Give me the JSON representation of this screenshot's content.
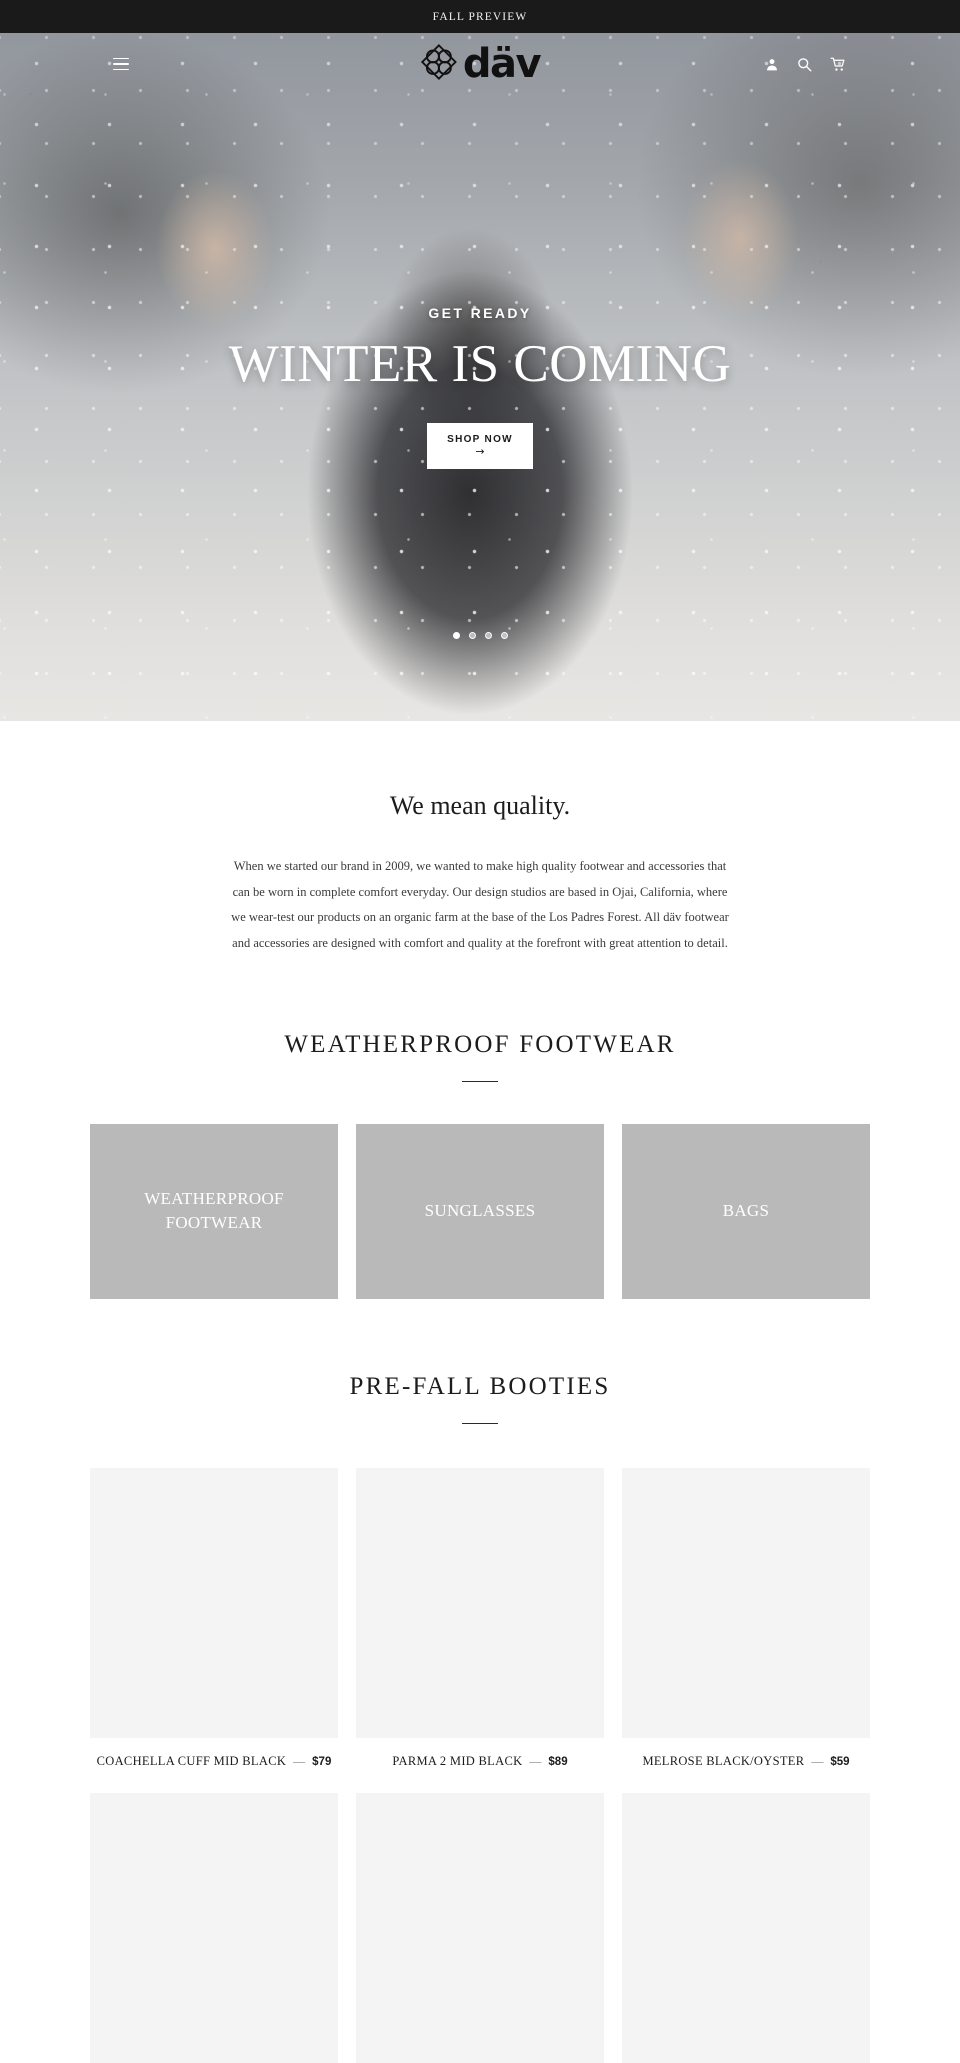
{
  "announcement": {
    "text": "FALL PREVIEW"
  },
  "header": {
    "menu_icon": "hamburger-menu-icon",
    "logo_text": "däv",
    "logo_mark": "four-petal-diamond-icon",
    "icons": [
      {
        "name": "account-icon",
        "label": "Account"
      },
      {
        "name": "search-icon",
        "label": "Search"
      },
      {
        "name": "cart-icon",
        "label": "Cart"
      }
    ]
  },
  "hero": {
    "eyebrow": "GET READY",
    "title": "WINTER IS COMING",
    "button_label": "SHOP NOW",
    "button_arrow": "→",
    "slides": 4,
    "active_slide": 1
  },
  "quality": {
    "title": "We mean quality.",
    "body": "When we started our brand in 2009, we wanted to make high quality footwear and accessories that can be worn in complete comfort everyday.  Our design studios are based in Ojai, California, where we wear-test our products on an organic farm at the base of the Los Padres Forest.  All däv footwear and accessories are designed with comfort and quality at the forefront with great attention to detail."
  },
  "categories_section": {
    "title": "WEATHERPROOF FOOTWEAR",
    "tiles": [
      {
        "label": "WEATHERPROOF FOOTWEAR"
      },
      {
        "label": "SUNGLASSES"
      },
      {
        "label": "BAGS"
      }
    ]
  },
  "products_section": {
    "title": "PRE-FALL BOOTIES",
    "separator": "—",
    "products": [
      {
        "name": "COACHELLA CUFF MID BLACK",
        "price": "$79"
      },
      {
        "name": "PARMA 2 MID BLACK",
        "price": "$89"
      },
      {
        "name": "MELROSE BLACK/OYSTER",
        "price": "$59"
      },
      {
        "name": "",
        "price": ""
      },
      {
        "name": "",
        "price": ""
      },
      {
        "name": "",
        "price": ""
      }
    ]
  },
  "colors": {
    "announcement_bg": "#1a1a1a",
    "tile_bg": "#b9b9b9",
    "thumb_bg": "#f4f4f4",
    "text": "#1c1c1c"
  }
}
